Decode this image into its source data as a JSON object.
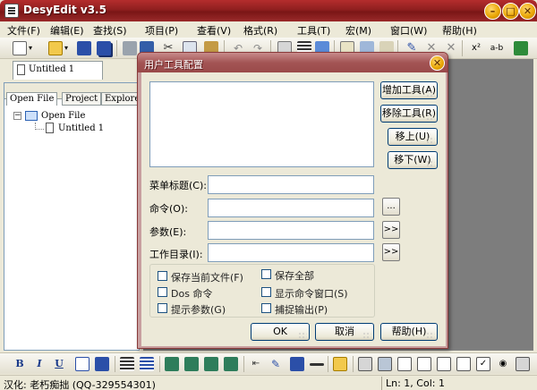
{
  "window": {
    "title": "DesyEdit v3.5",
    "min": "–",
    "max": "□",
    "close": "✕"
  },
  "menu": [
    "文件(F)",
    "编辑(E)",
    "查找(S)",
    "项目(P)",
    "查看(V)",
    "格式(R)",
    "工具(T)",
    "宏(M)",
    "窗口(W)",
    "帮助(H)"
  ],
  "toolbar": {
    "ab_label": "a-b"
  },
  "doc_tab": "Untitled 1",
  "panel": {
    "tabs": [
      "Open File",
      "Project",
      "Explorer"
    ],
    "tree_root": "Open File",
    "tree_child": "Untitled 1"
  },
  "dialog": {
    "title": "用户工具配置",
    "close": "✕",
    "buttons": {
      "add": "增加工具(A)",
      "remove": "移除工具(R)",
      "up": "移上(U)",
      "down": "移下(W)",
      "ok": "OK",
      "cancel": "取消",
      "help": "帮助(H)"
    },
    "labels": {
      "menu_title": "菜单标题(C):",
      "command": "命令(O):",
      "params": "参数(E):",
      "workdir": "工作目录(I):"
    },
    "browse": "...",
    "arrow": ">>",
    "options": {
      "save_current": "保存当前文件(F)",
      "save_all": "保存全部",
      "dos_command": "Dos 命令",
      "show_cmd_window": "显示命令窗口(S)",
      "prompt_params": "提示参数(G)",
      "capture_output": "捕捉输出(P)"
    }
  },
  "format_toolbar": {
    "bold": "B",
    "italic": "I",
    "underline": "U"
  },
  "status": {
    "left": "汉化: 老朽痴拙 (QQ-329554301)",
    "right": "Ln: 1, Col: 1"
  }
}
